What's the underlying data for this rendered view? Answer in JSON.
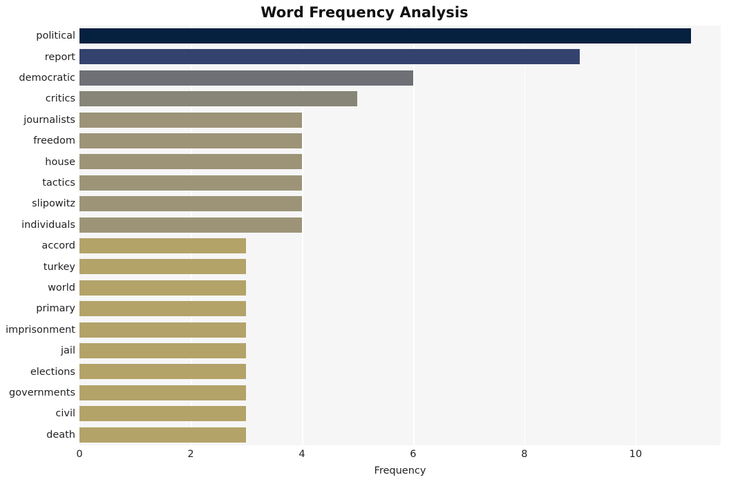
{
  "chart_data": {
    "type": "bar",
    "orientation": "horizontal",
    "title": "Word Frequency Analysis",
    "xlabel": "Frequency",
    "ylabel": "",
    "categories": [
      "political",
      "report",
      "democratic",
      "critics",
      "journalists",
      "freedom",
      "house",
      "tactics",
      "slipowitz",
      "individuals",
      "accord",
      "turkey",
      "world",
      "primary",
      "imprisonment",
      "jail",
      "elections",
      "governments",
      "civil",
      "death"
    ],
    "values": [
      11,
      9,
      6,
      5,
      4,
      4,
      4,
      4,
      4,
      4,
      3,
      3,
      3,
      3,
      3,
      3,
      3,
      3,
      3,
      3
    ],
    "bar_colors": [
      "#06203f",
      "#33436e",
      "#6e7076",
      "#868577",
      "#9c9378",
      "#9d9478",
      "#9d9478",
      "#9d9478",
      "#9d9478",
      "#9d9478",
      "#b3a369",
      "#b3a369",
      "#b3a369",
      "#b3a369",
      "#b3a369",
      "#b3a369",
      "#b3a369",
      "#b3a369",
      "#b3a369",
      "#b3a369"
    ],
    "xlim": [
      0,
      11.53
    ],
    "ylim_count": 20,
    "xticks": [
      0,
      2,
      4,
      6,
      8,
      10
    ],
    "xtick_labels": [
      "0",
      "2",
      "4",
      "6",
      "8",
      "10"
    ],
    "grid": {
      "vertical": true,
      "horizontal": false,
      "color": "#ffffff"
    },
    "legend": null,
    "plot_background": "#f6f6f7",
    "figure_background": "#ffffff"
  }
}
